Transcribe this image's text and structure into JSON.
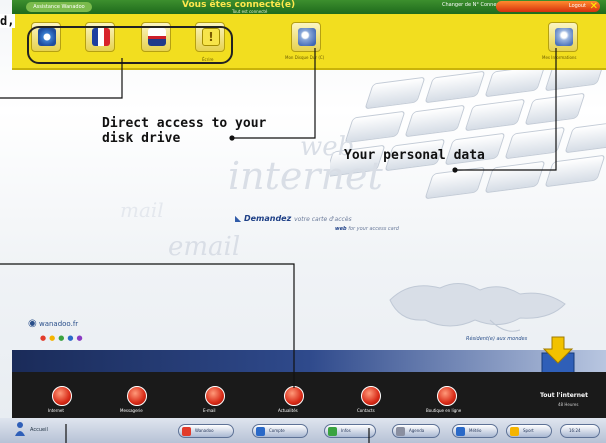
{
  "titlebar": {
    "home_label": "Assistance Wanadoo",
    "title": "Vous êtes connecté(e)",
    "subtitle": "Tout est connecté",
    "status": "Changer de N° Connexion",
    "logout_label": "Logout"
  },
  "toolbar": {
    "small_label": "Écrire",
    "disk_caption": "Mon Disque Dur (C)",
    "data_caption": "Mes Informations"
  },
  "main": {
    "ghost_words": [
      "web",
      "internet",
      "email",
      "mail"
    ],
    "banner_brand": "Demandez",
    "banner_rest": "votre carte d'accès",
    "banner_line2_bold": "web",
    "banner_line2_rest": "for your access card",
    "logo_text": "wanadoo.fr",
    "resident_text": "Résident(e) aux mondes"
  },
  "apps": [
    {
      "label": "Internet"
    },
    {
      "label": "Messagerie"
    },
    {
      "label": "E-mail"
    },
    {
      "label": "Actualités"
    },
    {
      "label": "Contacts"
    },
    {
      "label": "Boutique en ligne"
    }
  ],
  "tout_internet": {
    "title": "Tout l'internet",
    "subtitle": "48 Heures"
  },
  "taskbar": {
    "start_label": "Accueil",
    "tasks": [
      "Wanadoo",
      "Compte",
      "Infos",
      "Agenda",
      "Météo",
      "Sport"
    ],
    "clock": "16:24"
  },
  "callouts": {
    "left_fragment": "d,",
    "disk_line1": "Direct access to your",
    "disk_line2": "disk drive",
    "personal": "Your personal data"
  },
  "colors": {
    "toolbar": "#f2de1f",
    "titlebar": "#2a7a25",
    "navy": "#1a2b59",
    "app_button": "#d82a17"
  }
}
